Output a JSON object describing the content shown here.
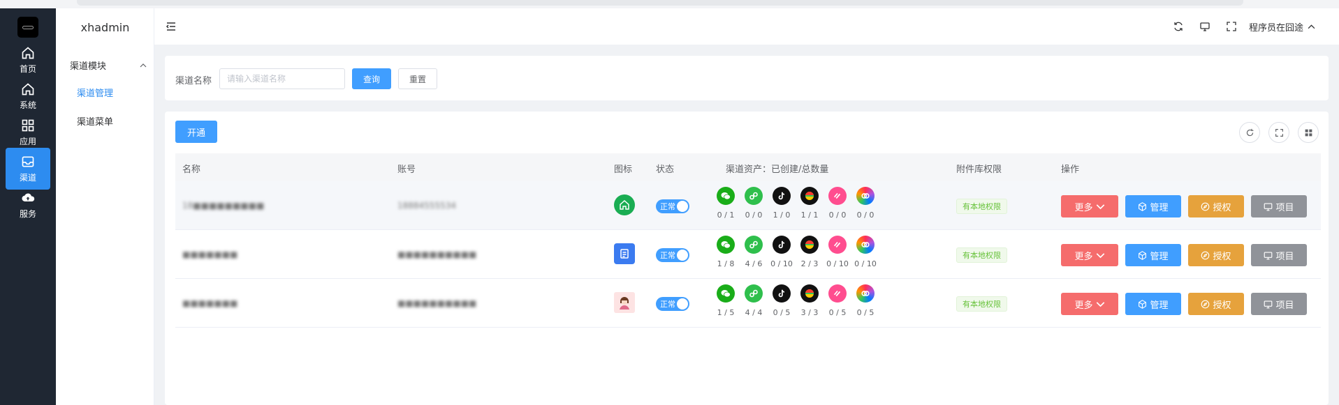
{
  "app": {
    "brand": "xhadmin"
  },
  "rail": [
    {
      "label": "首页",
      "icon": "home-icon"
    },
    {
      "label": "系统",
      "icon": "home-icon"
    },
    {
      "label": "应用",
      "icon": "grid-icon"
    },
    {
      "label": "渠道",
      "icon": "inbox-icon",
      "active": true
    },
    {
      "label": "服务",
      "icon": "cloud-upload-icon"
    }
  ],
  "subnav": {
    "group": "渠道模块",
    "items": [
      {
        "label": "渠道管理",
        "active": true
      },
      {
        "label": "渠道菜单",
        "active": false
      }
    ]
  },
  "header": {
    "user": "程序员在囧途"
  },
  "search": {
    "label": "渠道名称",
    "placeholder": "请输入渠道名称",
    "query_btn": "查询",
    "reset_btn": "重置"
  },
  "toolbar": {
    "open_btn": "开通"
  },
  "table": {
    "headers": {
      "name": "名称",
      "account": "账号",
      "icon": "图标",
      "status": "状态",
      "assets": "渠道资产：已创建/总数量",
      "attach": "附件库权限",
      "ops": "操作"
    },
    "rows": [
      {
        "name": "18■■■■■■■■■",
        "account": "18884555534",
        "status": "正常",
        "tag": "有本地权限",
        "counts": [
          "0 / 1",
          "0 / 0",
          "1 / 0",
          "1 / 1",
          "0 / 0",
          "0 / 0"
        ]
      },
      {
        "name": "■■■■■■■",
        "account": "■■■■■■■■■■",
        "status": "正常",
        "tag": "有本地权限",
        "counts": [
          "1 / 8",
          "4 / 6",
          "0 / 10",
          "2 / 3",
          "0 / 10",
          "0 / 10"
        ]
      },
      {
        "name": "■■■■■■■",
        "account": "■■■■■■■■■■",
        "status": "正常",
        "tag": "有本地权限",
        "counts": [
          "1 / 5",
          "4 / 4",
          "0 / 5",
          "3 / 3",
          "0 / 5",
          "0 / 5"
        ]
      }
    ],
    "actions": {
      "more": "更多",
      "manage": "管理",
      "auth": "授权",
      "project": "项目"
    }
  },
  "colors": {
    "primary": "#409eff",
    "danger": "#f56c6c",
    "warning": "#e6a23c",
    "gray": "#909399",
    "rail_bg": "#1f2733",
    "wechat": "#1aad19",
    "miniapp": "#2fbf4c",
    "douyin": "#111111",
    "pink": "#ff4d8f"
  }
}
